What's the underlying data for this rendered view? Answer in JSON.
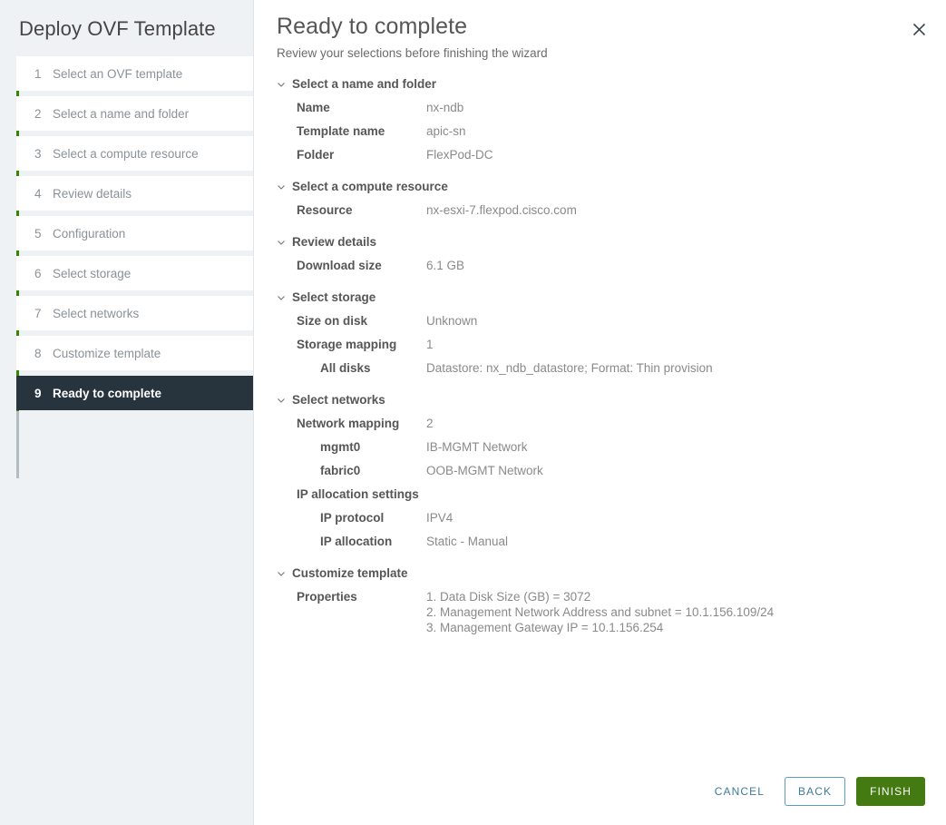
{
  "wizard": {
    "title": "Deploy OVF Template",
    "close_icon": "close-icon"
  },
  "sidebar": {
    "steps": [
      {
        "num": "1",
        "label": "Select an OVF template",
        "active": false
      },
      {
        "num": "2",
        "label": "Select a name and folder",
        "active": false
      },
      {
        "num": "3",
        "label": "Select a compute resource",
        "active": false
      },
      {
        "num": "4",
        "label": "Review details",
        "active": false
      },
      {
        "num": "5",
        "label": "Configuration",
        "active": false
      },
      {
        "num": "6",
        "label": "Select storage",
        "active": false
      },
      {
        "num": "7",
        "label": "Select networks",
        "active": false
      },
      {
        "num": "8",
        "label": "Customize template",
        "active": false
      },
      {
        "num": "9",
        "label": "Ready to complete",
        "active": true
      }
    ]
  },
  "page": {
    "title": "Ready to complete",
    "subtitle": "Review your selections before finishing the wizard"
  },
  "sections": [
    {
      "id": "name-and-folder",
      "heading": "Select a name and folder",
      "rows": [
        {
          "key": "Name",
          "value": "nx-ndb",
          "indent": false
        },
        {
          "key": "Template name",
          "value": "apic-sn",
          "indent": false
        },
        {
          "key": "Folder",
          "value": "FlexPod-DC",
          "indent": false
        }
      ]
    },
    {
      "id": "compute-resource",
      "heading": "Select a compute resource",
      "rows": [
        {
          "key": "Resource",
          "value": "nx-esxi-7.flexpod.cisco.com",
          "indent": false
        }
      ]
    },
    {
      "id": "review-details",
      "heading": "Review details",
      "rows": [
        {
          "key": "Download size",
          "value": "6.1 GB",
          "indent": false
        }
      ]
    },
    {
      "id": "select-storage",
      "heading": "Select storage",
      "rows": [
        {
          "key": "Size on disk",
          "value": "Unknown",
          "indent": false
        },
        {
          "key": "Storage mapping",
          "value": "1",
          "indent": false
        },
        {
          "key": "All disks",
          "value": "Datastore: nx_ndb_datastore; Format: Thin provision",
          "indent": true
        }
      ]
    },
    {
      "id": "select-networks",
      "heading": "Select networks",
      "rows": [
        {
          "key": "Network mapping",
          "value": "2",
          "indent": false
        },
        {
          "key": "mgmt0",
          "value": "IB-MGMT Network",
          "indent": true
        },
        {
          "key": "fabric0",
          "value": "OOB-MGMT Network",
          "indent": true
        },
        {
          "key": "IP allocation settings",
          "value": "",
          "indent": false
        },
        {
          "key": "IP protocol",
          "value": "IPV4",
          "indent": true
        },
        {
          "key": "IP allocation",
          "value": "Static - Manual",
          "indent": true
        }
      ]
    },
    {
      "id": "customize-template",
      "heading": "Customize template",
      "rows": [
        {
          "key": "Properties",
          "value": "1. Data Disk Size (GB) = 3072\n2. Management Network Address and subnet = 10.1.156.109/24\n3. Management Gateway IP = 10.1.156.254",
          "indent": false,
          "multiline": true
        }
      ]
    }
  ],
  "footer": {
    "cancel_label": "CANCEL",
    "back_label": "BACK",
    "finish_label": "FINISH"
  },
  "colors": {
    "accent_green": "#318700",
    "finish_green": "#437a11",
    "link_blue": "#3d7b9c",
    "active_step_bg": "#27333d",
    "sidebar_bg": "#eef2f5"
  }
}
